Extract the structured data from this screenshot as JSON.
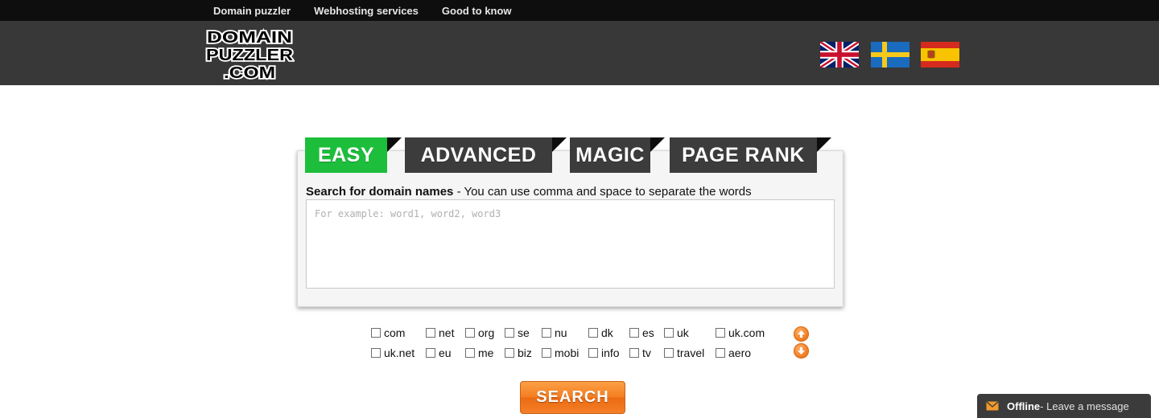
{
  "topnav": {
    "items": [
      "Domain puzzler",
      "Webhosting services",
      "Good to know"
    ]
  },
  "logo": {
    "lines": [
      "DOMAIN",
      "PUZZLER",
      ".COM"
    ]
  },
  "languages": [
    {
      "name": "uk-flag-icon"
    },
    {
      "name": "sweden-flag-icon"
    },
    {
      "name": "spain-flag-icon"
    }
  ],
  "tabs": [
    "EASY",
    "ADVANCED",
    "MAGIC",
    "PAGE RANK"
  ],
  "search": {
    "title_bold": "Search for domain names",
    "title_rest": " - You can use comma and space to separate the words",
    "placeholder": "For example: word1, word2, word3",
    "value": ""
  },
  "tlds": {
    "row1": [
      "com",
      "net",
      "org",
      "se",
      "nu",
      "dk",
      "es",
      "uk",
      "uk.com"
    ],
    "row2": [
      "uk.net",
      "eu",
      "me",
      "biz",
      "mobi",
      "info",
      "tv",
      "travel",
      "aero"
    ]
  },
  "button": {
    "label": "SEARCH"
  },
  "chat": {
    "status": "Offline",
    "text": " - Leave a message"
  },
  "colors": {
    "accent_green": "#1dbe3b",
    "button_orange": "#f47e22",
    "header_dark": "#383838"
  }
}
